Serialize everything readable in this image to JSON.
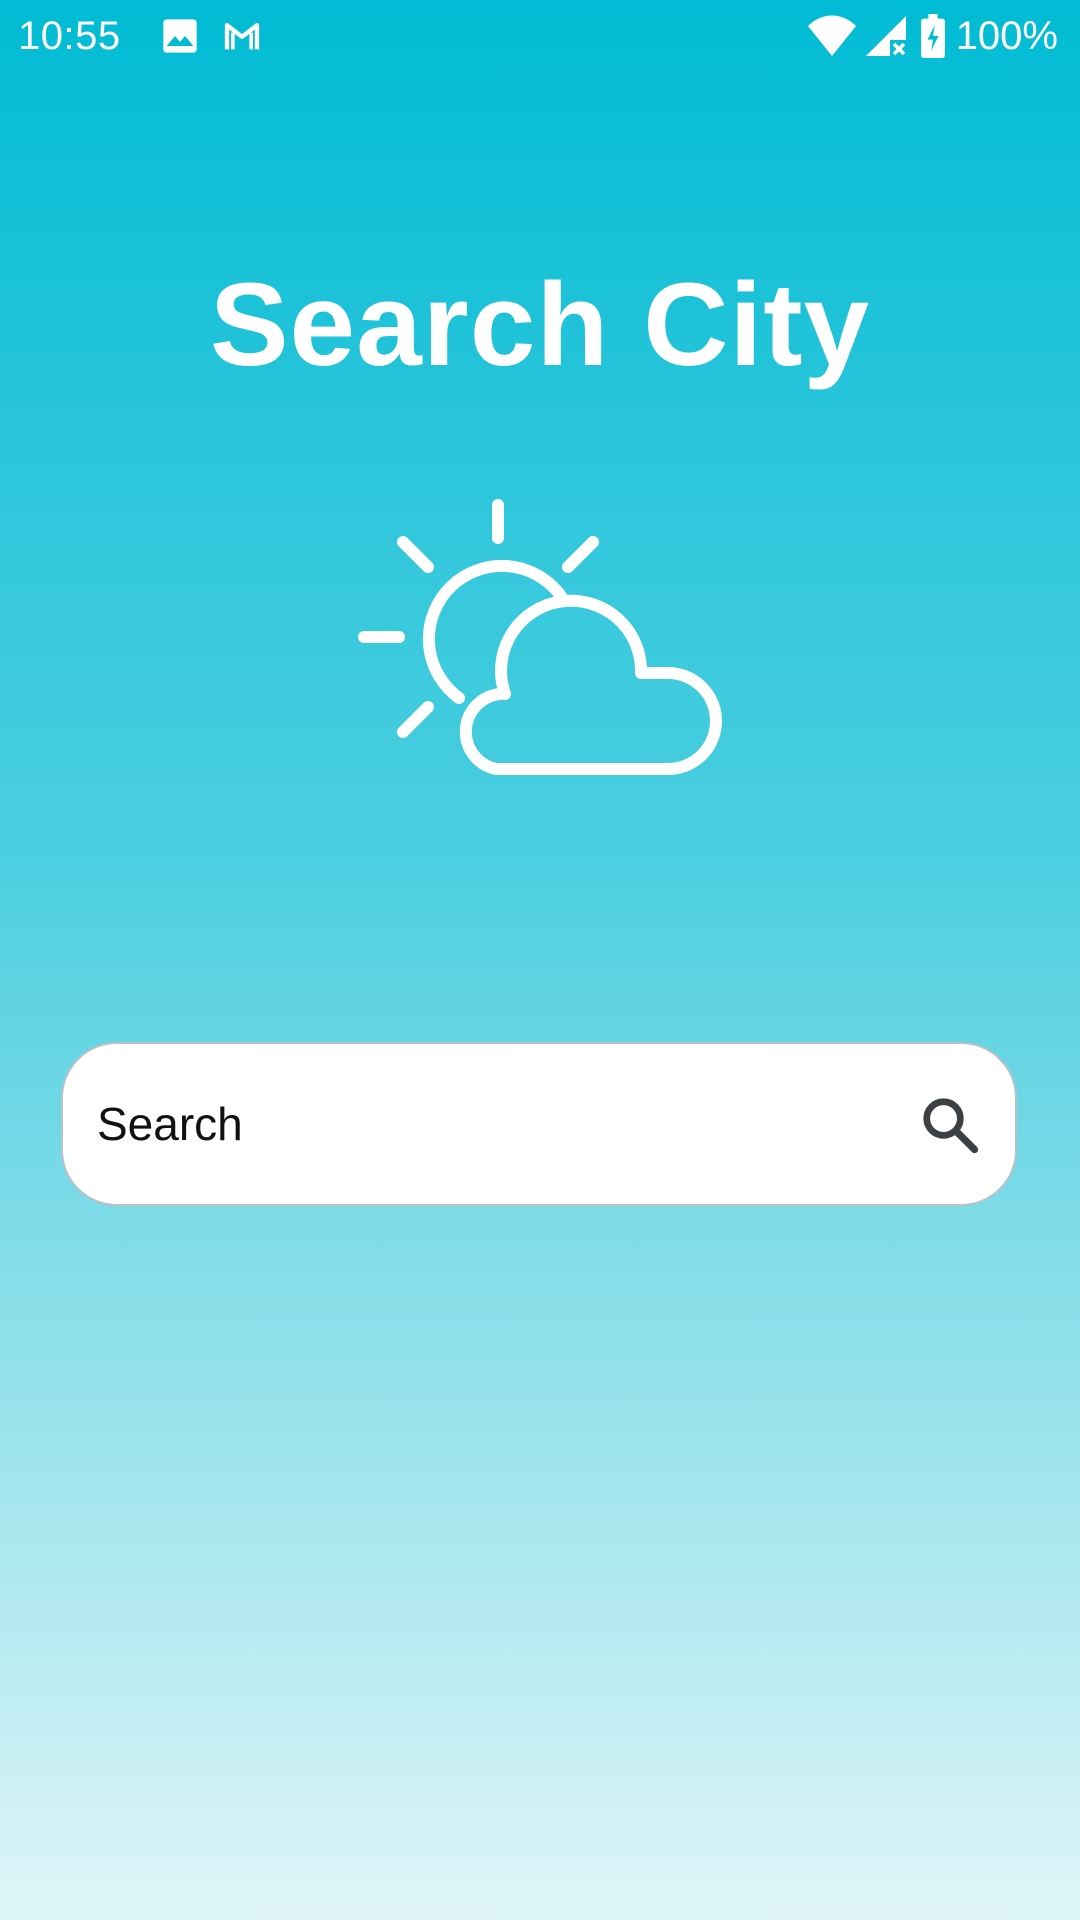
{
  "status_bar": {
    "time": "10:55",
    "battery_percent": "100%",
    "left_icons": [
      "image-icon",
      "gmail-icon"
    ],
    "right_icons": [
      "wifi-icon",
      "cellular-no-signal-icon",
      "battery-charging-icon"
    ]
  },
  "page": {
    "title": "Search City",
    "illustration": "partly-cloudy-icon"
  },
  "search": {
    "placeholder": "Search",
    "value": "",
    "button_icon": "search-icon"
  },
  "colors": {
    "gradient_top": "#00BCD4",
    "gradient_bottom": "#DFF5F8",
    "text_on_background": "#FFFFFF",
    "search_box_background": "#FFFFFF",
    "search_icon_color": "#3C4043"
  }
}
